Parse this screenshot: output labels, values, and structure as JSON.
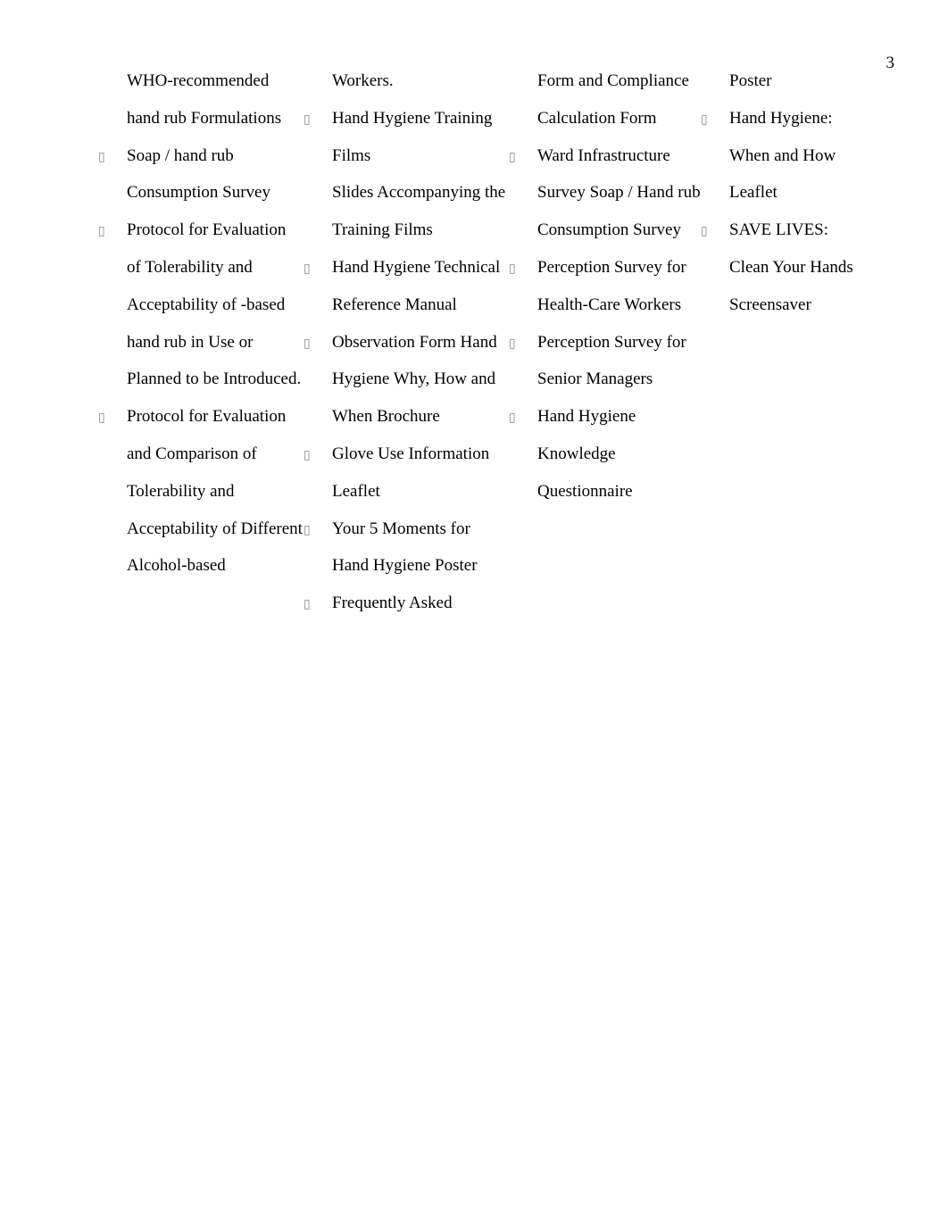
{
  "page_number": "3",
  "bullet_glyph": "▯",
  "col1": {
    "cont0": "WHO-recommended hand rub Formulations",
    "item1": "Soap / hand rub Consumption Survey",
    "item2": "Protocol for Evaluation of Tolerability and Acceptability of -based hand rub in Use or Planned to be Introduced.",
    "item3": "Protocol for Evaluation and Comparison of Tolerability and Acceptability of Different Alcohol-based"
  },
  "col2": {
    "cont0": "Workers.",
    "item1": "Hand Hygiene Training Films",
    "item2": "Slides Accompanying the Training Films",
    "item3": "Hand Hygiene Technical Reference Manual",
    "item4": "Observation Form Hand Hygiene Why, How and When Brochure",
    "item5": "Glove Use Information Leaflet",
    "item6": "Your 5 Moments for Hand Hygiene Poster",
    "item7": "Frequently Asked"
  },
  "col3": {
    "cont0": "Form and Compliance Calculation Form",
    "item1": "Ward Infrastructure Survey Soap / Hand rub Consumption Survey",
    "item2": "Perception Survey for Health-Care Workers",
    "item3": "Perception Survey for Senior Managers",
    "item4": "Hand Hygiene Knowledge Questionnaire"
  },
  "col4": {
    "cont0": "Poster",
    "item1": "Hand Hygiene: When and How Leaflet",
    "item2": "SAVE LIVES: Clean Your Hands Screensaver"
  }
}
